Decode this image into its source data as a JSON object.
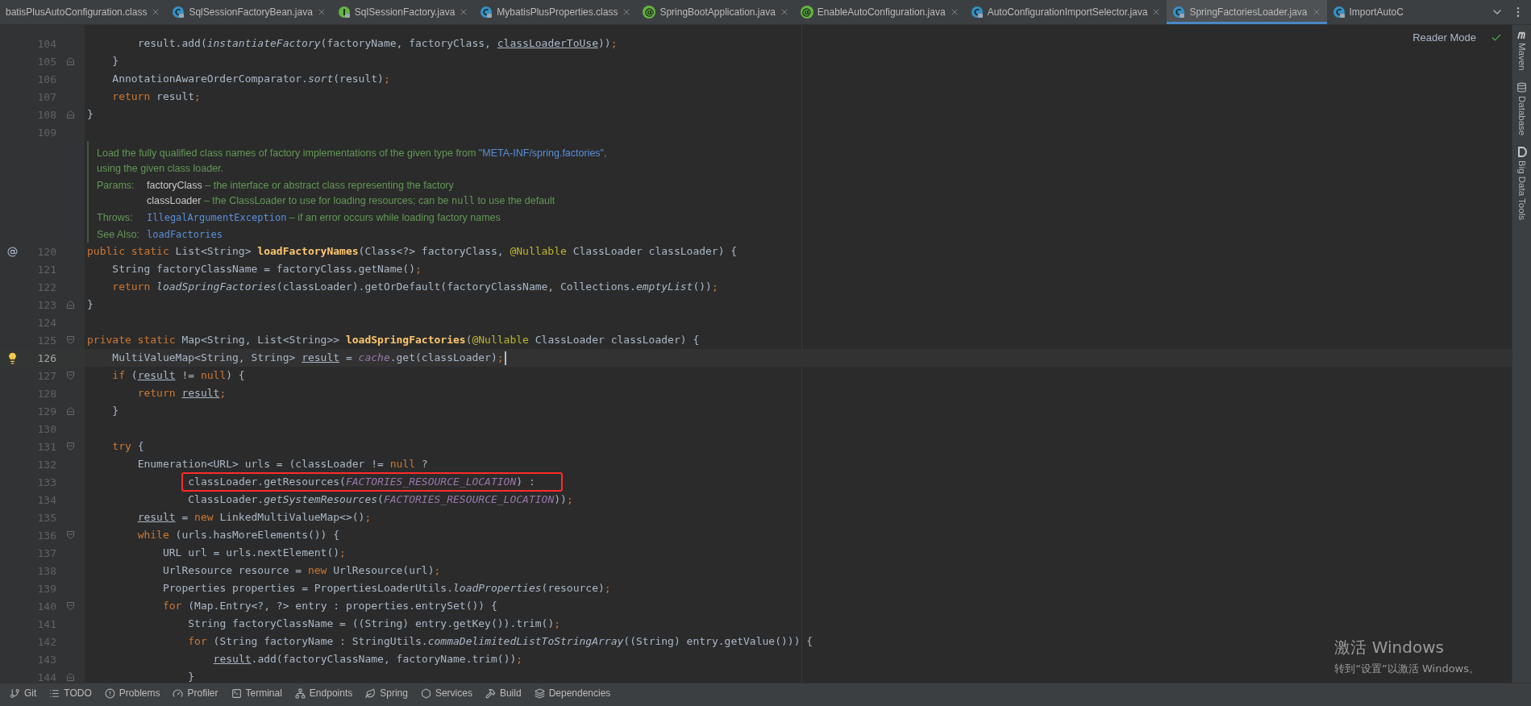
{
  "tabs": [
    {
      "label": "batisPlusAutoConfiguration.class",
      "kind": "none",
      "selected": false,
      "closable": true
    },
    {
      "label": "SqlSessionFactoryBean.java",
      "kind": "class",
      "selected": false,
      "closable": true
    },
    {
      "label": "SqlSessionFactory.java",
      "kind": "interface",
      "selected": false,
      "closable": true
    },
    {
      "label": "MybatisPlusProperties.class",
      "kind": "class",
      "selected": false,
      "closable": true
    },
    {
      "label": "SpringBootApplication.java",
      "kind": "annotation",
      "selected": false,
      "closable": true
    },
    {
      "label": "EnableAutoConfiguration.java",
      "kind": "annotation",
      "selected": false,
      "closable": true
    },
    {
      "label": "AutoConfigurationImportSelector.java",
      "kind": "class",
      "selected": false,
      "closable": true
    },
    {
      "label": "SpringFactoriesLoader.java",
      "kind": "class",
      "selected": true,
      "closable": true
    },
    {
      "label": "ImportAutoC",
      "kind": "class",
      "selected": false,
      "closable": false
    }
  ],
  "reader_mode": "Reader Mode",
  "lines": [
    {
      "kind": "code",
      "number": "104",
      "tokens": [
        {
          "t": "        result.add("
        },
        {
          "t": "instantiateFactory",
          "kind": "st"
        },
        {
          "t": "(factoryName, factoryClass, "
        },
        {
          "t": "classLoaderToUse",
          "kind": "var"
        },
        {
          "t": "))"
        },
        {
          "t": ";",
          "kind": "punct"
        }
      ]
    },
    {
      "kind": "code",
      "number": "105",
      "fold_end": true,
      "tokens": [
        {
          "t": "    }"
        }
      ]
    },
    {
      "kind": "code",
      "number": "106",
      "tokens": [
        {
          "t": "    AnnotationAwareOrderComparator."
        },
        {
          "t": "sort",
          "kind": "st"
        },
        {
          "t": "(result)"
        },
        {
          "t": ";",
          "kind": "punct"
        }
      ]
    },
    {
      "kind": "code",
      "number": "107",
      "tokens": [
        {
          "t": "    return ",
          "kind": "kw"
        },
        {
          "t": "result"
        },
        {
          "t": ";",
          "kind": "punct"
        }
      ]
    },
    {
      "kind": "code",
      "number": "108",
      "fold_end": true,
      "tokens": [
        {
          "t": "}"
        }
      ]
    },
    {
      "kind": "code",
      "number": "109"
    },
    {
      "kind": "doc",
      "summary": [
        {
          "t": "Load the fully qualified class names of factory implementations of the given type from "
        },
        {
          "t": "\"META-INF/spring.factories\"",
          "kind": "link"
        },
        {
          "t": ", using the given class loader."
        }
      ],
      "sections": [
        {
          "label": "Params:",
          "entries": [
            [
              {
                "t": "factoryClass",
                "kind": "name"
              },
              {
                "t": " – the interface or abstract class representing the factory"
              }
            ],
            [
              {
                "t": "classLoader",
                "kind": "name"
              },
              {
                "t": " – the ClassLoader to use for loading resources; can be "
              },
              {
                "t": "null",
                "kind": "code"
              },
              {
                "t": " to use the default"
              }
            ]
          ]
        },
        {
          "label": "Throws:",
          "entries": [
            [
              {
                "t": "IllegalArgumentException",
                "kind": "link-code"
              },
              {
                "t": " – if an error occurs while loading factory names"
              }
            ]
          ]
        },
        {
          "label": "See Also:",
          "entries": [
            [
              {
                "t": "loadFactories",
                "kind": "link-code"
              }
            ]
          ]
        }
      ]
    },
    {
      "kind": "code",
      "number": "120",
      "gutter": {
        "kind": "annotation"
      },
      "tokens": [
        {
          "t": "public static ",
          "kind": "kw"
        },
        {
          "t": "List<String> "
        },
        {
          "t": "loadFactoryNames",
          "kind": "fn"
        },
        {
          "t": "(Class<?> factoryClass, "
        },
        {
          "t": "@Nullable",
          "kind": "ann"
        },
        {
          "t": " ClassLoader classLoader) {"
        }
      ]
    },
    {
      "kind": "code",
      "number": "121",
      "tokens": [
        {
          "t": "    String factoryClassName = factoryClass.getName()"
        },
        {
          "t": ";",
          "kind": "punct"
        }
      ]
    },
    {
      "kind": "code",
      "number": "122",
      "tokens": [
        {
          "t": "    return ",
          "kind": "kw"
        },
        {
          "t": "loadSpringFactories",
          "kind": "st"
        },
        {
          "t": "(classLoader).getOrDefault(factoryClassName, Collections."
        },
        {
          "t": "emptyList",
          "kind": "st"
        },
        {
          "t": "())"
        },
        {
          "t": ";",
          "kind": "punct"
        }
      ]
    },
    {
      "kind": "code",
      "number": "123",
      "fold_end": true,
      "tokens": [
        {
          "t": "}"
        }
      ]
    },
    {
      "kind": "code",
      "number": "124"
    },
    {
      "kind": "code",
      "number": "125",
      "fold_start": true,
      "tokens": [
        {
          "t": "private static ",
          "kind": "kw"
        },
        {
          "t": "Map<String, List<String>> "
        },
        {
          "t": "loadSpringFactories",
          "kind": "fn"
        },
        {
          "t": "("
        },
        {
          "t": "@Nullable",
          "kind": "ann"
        },
        {
          "t": " ClassLoader classLoader) {"
        }
      ]
    },
    {
      "kind": "code",
      "number": "126",
      "current": true,
      "gutter": {
        "kind": "intention"
      },
      "tokens": [
        {
          "t": "    MultiValueMap<String, String> "
        },
        {
          "t": "result",
          "kind": "var"
        },
        {
          "t": " = "
        },
        {
          "t": "cache",
          "kind": "const"
        },
        {
          "t": ".get(classLoader)"
        },
        {
          "t": ";",
          "kind": "punct"
        }
      ]
    },
    {
      "kind": "code",
      "number": "127",
      "fold_start": true,
      "tokens": [
        {
          "t": "    if ",
          "kind": "kw"
        },
        {
          "t": "("
        },
        {
          "t": "result",
          "kind": "var"
        },
        {
          "t": " != "
        },
        {
          "t": "null",
          "kind": "kw"
        },
        {
          "t": ") {"
        }
      ]
    },
    {
      "kind": "code",
      "number": "128",
      "tokens": [
        {
          "t": "        return ",
          "kind": "kw"
        },
        {
          "t": "result",
          "kind": "var"
        },
        {
          "t": ";",
          "kind": "punct"
        }
      ]
    },
    {
      "kind": "code",
      "number": "129",
      "fold_end": true,
      "tokens": [
        {
          "t": "    }"
        }
      ]
    },
    {
      "kind": "code",
      "number": "130"
    },
    {
      "kind": "code",
      "number": "131",
      "fold_start": true,
      "tokens": [
        {
          "t": "    try ",
          "kind": "kw"
        },
        {
          "t": "{"
        }
      ]
    },
    {
      "kind": "code",
      "number": "132",
      "tokens": [
        {
          "t": "        Enumeration<URL> urls = (classLoader != "
        },
        {
          "t": "null ",
          "kind": "kw"
        },
        {
          "t": "?"
        }
      ]
    },
    {
      "kind": "code",
      "number": "133",
      "boxed": true,
      "tokens": [
        {
          "t": "                classLoader.getResources("
        },
        {
          "t": "FACTORIES_RESOURCE_LOCATION",
          "kind": "const"
        },
        {
          "t": ") :"
        }
      ]
    },
    {
      "kind": "code",
      "number": "134",
      "tokens": [
        {
          "t": "                ClassLoader."
        },
        {
          "t": "getSystemResources",
          "kind": "st"
        },
        {
          "t": "("
        },
        {
          "t": "FACTORIES_RESOURCE_LOCATION",
          "kind": "const"
        },
        {
          "t": "))"
        },
        {
          "t": ";",
          "kind": "punct"
        }
      ]
    },
    {
      "kind": "code",
      "number": "135",
      "tokens": [
        {
          "t": "        result",
          "kind": "var"
        },
        {
          "t": " = "
        },
        {
          "t": "new ",
          "kind": "kw"
        },
        {
          "t": "LinkedMultiValueMap<>()"
        },
        {
          "t": ";",
          "kind": "punct"
        }
      ]
    },
    {
      "kind": "code",
      "number": "136",
      "fold_start": true,
      "tokens": [
        {
          "t": "        while ",
          "kind": "kw"
        },
        {
          "t": "(urls.hasMoreElements()) {"
        }
      ]
    },
    {
      "kind": "code",
      "number": "137",
      "tokens": [
        {
          "t": "            URL url = urls.nextElement()"
        },
        {
          "t": ";",
          "kind": "punct"
        }
      ]
    },
    {
      "kind": "code",
      "number": "138",
      "tokens": [
        {
          "t": "            UrlResource resource = "
        },
        {
          "t": "new ",
          "kind": "kw"
        },
        {
          "t": "UrlResource(url)"
        },
        {
          "t": ";",
          "kind": "punct"
        }
      ]
    },
    {
      "kind": "code",
      "number": "139",
      "tokens": [
        {
          "t": "            Properties properties = PropertiesLoaderUtils."
        },
        {
          "t": "loadProperties",
          "kind": "st"
        },
        {
          "t": "(resource)"
        },
        {
          "t": ";",
          "kind": "punct"
        }
      ]
    },
    {
      "kind": "code",
      "number": "140",
      "fold_start": true,
      "tokens": [
        {
          "t": "            for ",
          "kind": "kw"
        },
        {
          "t": "(Map.Entry<?, ?> entry : properties.entrySet()) {"
        }
      ]
    },
    {
      "kind": "code",
      "number": "141",
      "tokens": [
        {
          "t": "                String factoryClassName = ((String) entry.getKey()).trim()"
        },
        {
          "t": ";",
          "kind": "punct"
        }
      ]
    },
    {
      "kind": "code",
      "number": "142",
      "tokens": [
        {
          "t": "                for ",
          "kind": "kw"
        },
        {
          "t": "(String factoryName : StringUtils."
        },
        {
          "t": "commaDelimitedListToStringArray",
          "kind": "st"
        },
        {
          "t": "((String) entry.getValue())) {"
        }
      ]
    },
    {
      "kind": "code",
      "number": "143",
      "tokens": [
        {
          "t": "                    result",
          "kind": "var"
        },
        {
          "t": ".add(factoryClassName, factoryName.trim())"
        },
        {
          "t": ";",
          "kind": "punct"
        }
      ]
    },
    {
      "kind": "code",
      "number": "144",
      "fold_end": true,
      "tokens": [
        {
          "t": "                }"
        }
      ]
    }
  ],
  "right_strip": [
    {
      "label": "Maven",
      "kind": "maven"
    },
    {
      "label": "Database",
      "kind": "database"
    },
    {
      "label": "Big Data Tools",
      "kind": "bigdata"
    }
  ],
  "tool_windows": [
    {
      "label": "Git",
      "kind": "git"
    },
    {
      "label": "TODO",
      "kind": "todo"
    },
    {
      "label": "Problems",
      "kind": "problems"
    },
    {
      "label": "Profiler",
      "kind": "profiler"
    },
    {
      "label": "Terminal",
      "kind": "terminal"
    },
    {
      "label": "Endpoints",
      "kind": "endpoints"
    },
    {
      "label": "Spring",
      "kind": "spring"
    },
    {
      "label": "Services",
      "kind": "services"
    },
    {
      "label": "Build",
      "kind": "build"
    },
    {
      "label": "Dependencies",
      "kind": "dependencies"
    }
  ],
  "activation": {
    "title": "激活 Windows",
    "hint": "转到“设置”以激活 Windows。"
  }
}
